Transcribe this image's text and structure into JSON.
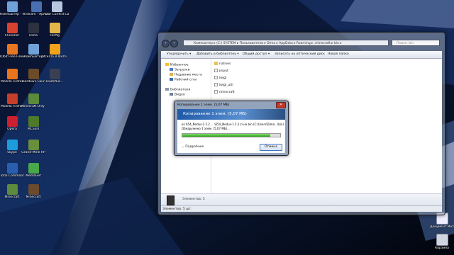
{
  "desktop_icons": [
    {
      "label": "Компьютер - Ярлык",
      "color": "#6fa2d8",
      "x": 0,
      "y": 0
    },
    {
      "label": "Ivdcam - Ярлык",
      "color": "#4a6fb0",
      "x": 0,
      "y": 0
    },
    {
      "label": "Star Conflict Launcher",
      "color": "#b7c7de",
      "x": 0,
      "y": 0
    },
    {
      "label": "CCleaner",
      "color": "#d8422f",
      "x": 0,
      "y": 0
    },
    {
      "label": "Dima",
      "color": "#2d3140",
      "x": 0,
      "y": 0
    },
    {
      "label": "config",
      "color": "#e3b64a",
      "x": 0,
      "y": 0
    },
    {
      "label": "IObit Free Firewall",
      "color": "#e87722",
      "x": 0,
      "y": 0
    },
    {
      "label": "Компьютер",
      "color": "#6fa2d8",
      "x": 0,
      "y": 0
    },
    {
      "label": "Искать в Интернете",
      "color": "#f2a31b",
      "x": 0,
      "y": 0
    },
    {
      "label": "Mozilla Firefox",
      "color": "#e8741d",
      "x": 0,
      "y": 0
    },
    {
      "label": "Teardown Launcher 3",
      "color": "#6c4b2a",
      "x": 0,
      "y": 0
    },
    {
      "label": "TeamPlus...",
      "color": "#3a3f52",
      "x": 0,
      "y": 0
    },
    {
      "label": "Mozilla Firefox",
      "color": "#c43e2a",
      "x": 0,
      "y": 0
    },
    {
      "label": "Minecraft Only La...",
      "color": "#5c8a3a",
      "x": 0,
      "y": 0
    },
    {
      "label": "Opera",
      "color": "#cc1f2f",
      "x": 0,
      "y": 0
    },
    {
      "label": "MCSkill",
      "color": "#4e7a2a",
      "x": 0,
      "y": 0
    },
    {
      "label": "Skype",
      "color": "#1c9cdc",
      "x": 0,
      "y": 0
    },
    {
      "label": "Grand-Mine RP",
      "color": "#6a8e3c",
      "x": 0,
      "y": 0
    },
    {
      "label": "Total Commander",
      "color": "#2a5fb0",
      "x": 0,
      "y": 0
    },
    {
      "label": "MediaGet",
      "color": "#48a84a",
      "x": 0,
      "y": 0
    },
    {
      "label": "Minecraft",
      "color": "#5d8a3d",
      "x": 0,
      "y": 0
    },
    {
      "label": "Minecraft",
      "color": "#6b4a2e",
      "x": 0,
      "y": 0
    }
  ],
  "right_icons": [
    {
      "label": "Документ Microso..."
    },
    {
      "label": "Корзина"
    }
  ],
  "explorer": {
    "address": "Компьютер ▸ (C:) SYSTEM ▸ Пользователи ▸ Dima ▸ AppData ▸ Roaming ▸ .minecraft ▸ bin ▸",
    "search_placeholder": "Поиск: bin",
    "toolbar": {
      "organize": "Упорядочить ▾",
      "add_library": "Добавить в библиотеку ▾",
      "share": "Общий доступ ▾",
      "burn": "Записать на оптический диск",
      "new_folder": "Новая папка"
    },
    "nav": {
      "favorites": "Избранное",
      "downloads": "Загрузки",
      "recent": "Недавние места",
      "desktop": "Рабочий стол",
      "libraries": "Библиотеки",
      "video": "Видео"
    },
    "files": [
      "natives",
      "jinput",
      "lwjgl",
      "lwjgl_util",
      "minecraft"
    ],
    "details_text": "Элементов: 5",
    "status_text": "Элементов: 5 шт."
  },
  "copy_dialog": {
    "title": "Копирование 1 элем. (5,07 МБ)",
    "heading": "Копирование 1 элем. (5,07 МБ)",
    "line1": "из 654_Nodus-1.5.2 ... \\654_Nodus-1.5.2.zi на bin (C:\\Users\\Dima...\\bin)",
    "line2": "Обнаружено 1 элем. (5,07 МБ)...",
    "progress": 0.9,
    "details_label": "Подробнее",
    "cancel_label": "Отмена"
  }
}
